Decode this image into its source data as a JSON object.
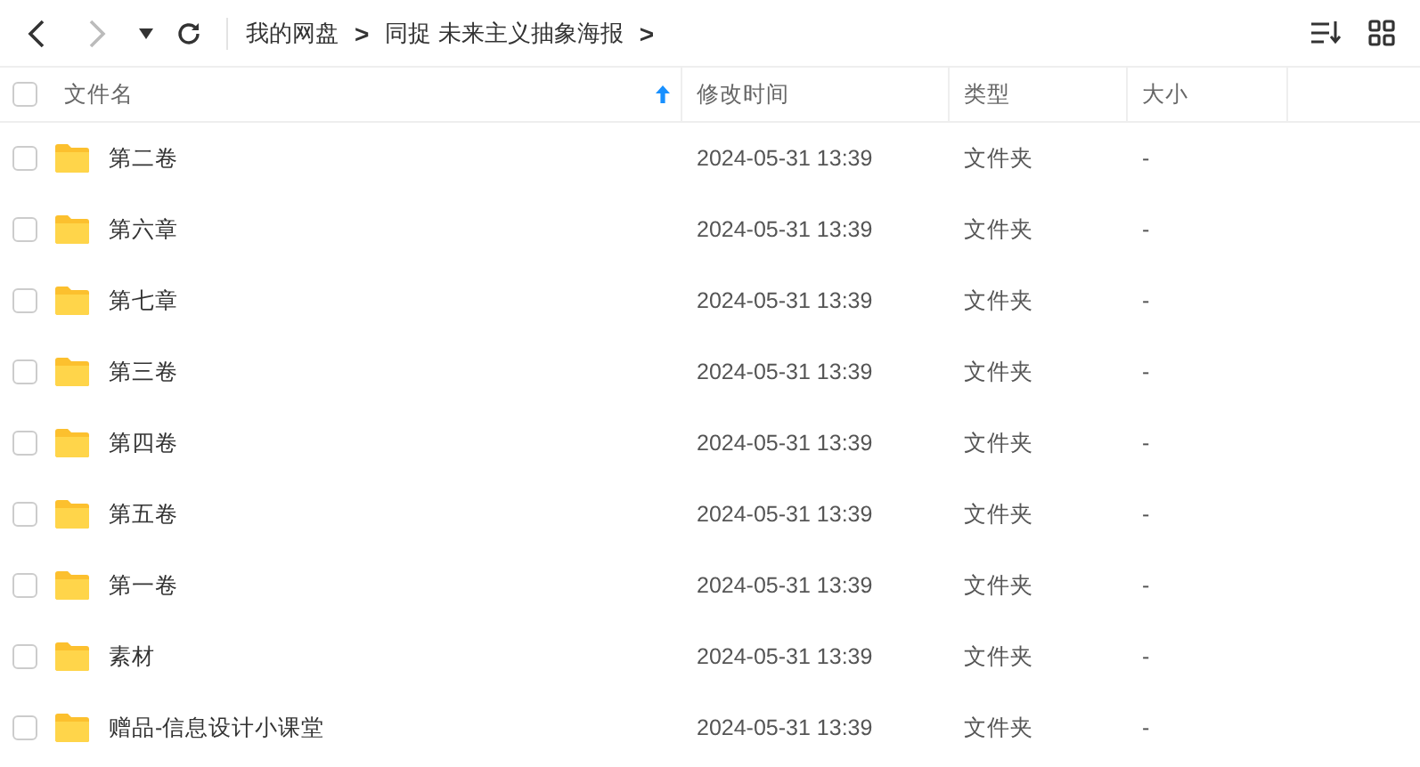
{
  "toolbar": {
    "back_enabled": true,
    "forward_enabled": false,
    "breadcrumb": [
      {
        "label": "我的网盘",
        "separator": ">"
      },
      {
        "label": "同捉 未来主义抽象海报",
        "separator": ">"
      }
    ]
  },
  "table": {
    "select_all": {
      "checked": false
    },
    "columns": [
      {
        "label": "文件名",
        "sorted": true
      },
      {
        "label": "修改时间",
        "sorted": false
      },
      {
        "label": "类型",
        "sorted": false
      },
      {
        "label": "大小",
        "sorted": false
      }
    ],
    "rows": [
      {
        "checked": false,
        "name": "第二卷",
        "modified": "2024-05-31 13:39",
        "type": "文件夹",
        "size": "-"
      },
      {
        "checked": false,
        "name": "第六章",
        "modified": "2024-05-31 13:39",
        "type": "文件夹",
        "size": "-"
      },
      {
        "checked": false,
        "name": "第七章",
        "modified": "2024-05-31 13:39",
        "type": "文件夹",
        "size": "-"
      },
      {
        "checked": false,
        "name": "第三卷",
        "modified": "2024-05-31 13:39",
        "type": "文件夹",
        "size": "-"
      },
      {
        "checked": false,
        "name": "第四卷",
        "modified": "2024-05-31 13:39",
        "type": "文件夹",
        "size": "-"
      },
      {
        "checked": false,
        "name": "第五卷",
        "modified": "2024-05-31 13:39",
        "type": "文件夹",
        "size": "-"
      },
      {
        "checked": false,
        "name": "第一卷",
        "modified": "2024-05-31 13:39",
        "type": "文件夹",
        "size": "-"
      },
      {
        "checked": false,
        "name": "素材",
        "modified": "2024-05-31 13:39",
        "type": "文件夹",
        "size": "-"
      },
      {
        "checked": false,
        "name": "赠品-信息设计小课堂",
        "modified": "2024-05-31 13:39",
        "type": "文件夹",
        "size": "-"
      }
    ]
  }
}
